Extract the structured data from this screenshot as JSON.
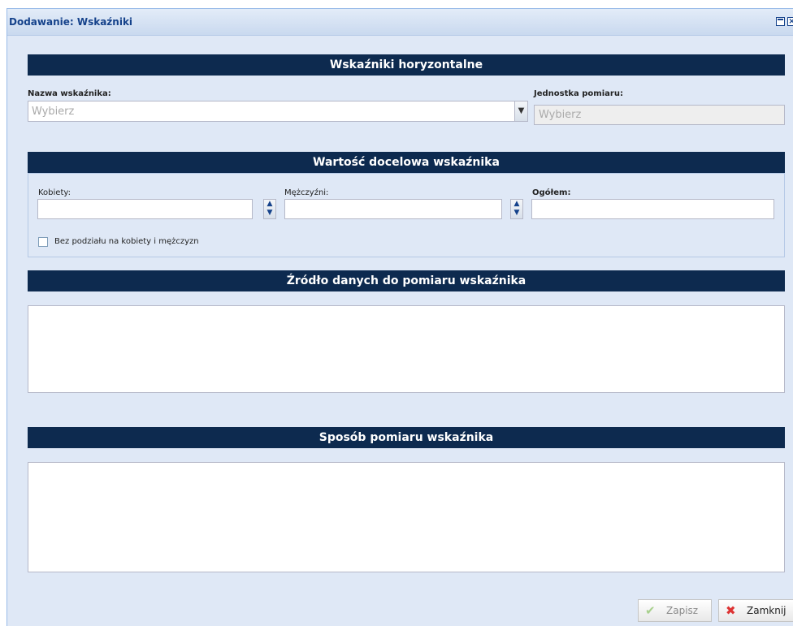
{
  "window": {
    "title": "Dodawanie: Wskaźniki"
  },
  "sections": {
    "horizontal": "Wskaźniki horyzontalne",
    "target": "Wartość docelowa wskaźnika",
    "source": "Źródło danych do pomiaru wskaźnika",
    "method": "Sposób pomiaru wskaźnika"
  },
  "indicator": {
    "name_label": "Nazwa wskaźnika:",
    "name_placeholder": "Wybierz",
    "unit_label": "Jednostka pomiaru:",
    "unit_placeholder": "Wybierz"
  },
  "target": {
    "women_label": "Kobiety:",
    "men_label": "Mężczyźni:",
    "total_label": "Ogółem:",
    "women_value": "",
    "men_value": "",
    "total_value": "",
    "no_split_label": "Bez podziału na kobiety i mężczyzn",
    "no_split_checked": false
  },
  "buttons": {
    "save": "Zapisz",
    "close": "Zamknij"
  },
  "colors": {
    "header_bg": "#0d2a4f",
    "window_bg": "#dfe8f6",
    "title_color": "#15428b"
  }
}
